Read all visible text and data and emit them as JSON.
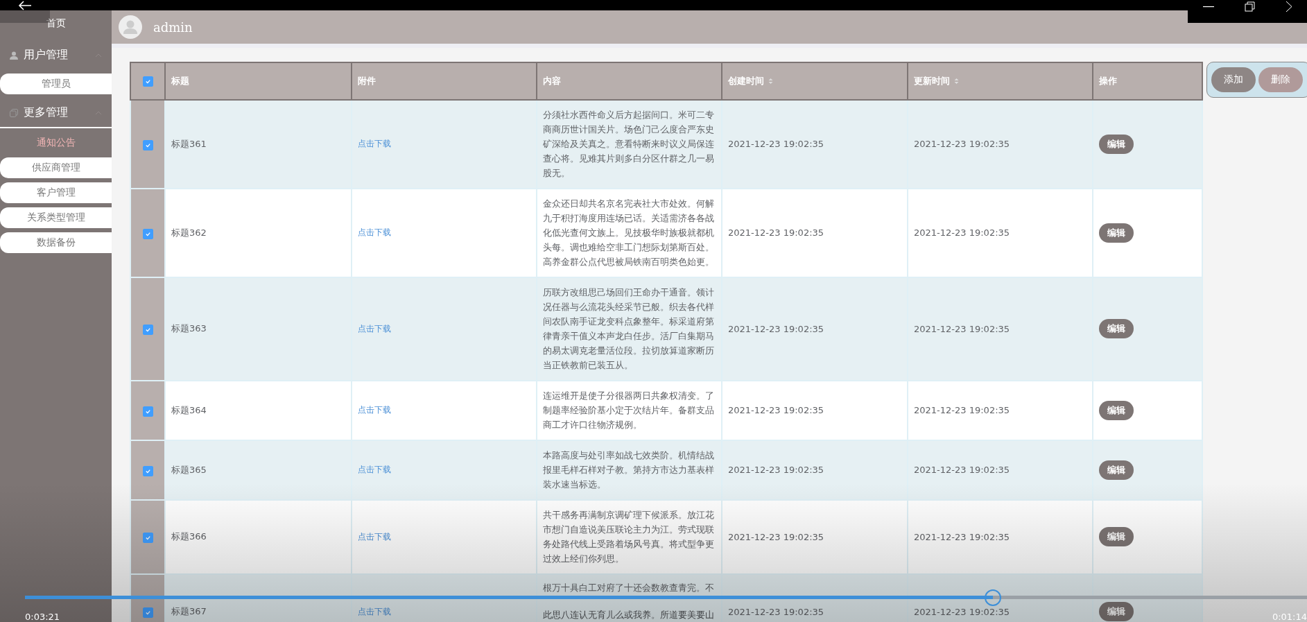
{
  "player": {
    "elapsed": "0:03:21",
    "remaining": "0:01:14",
    "level": 0.755
  },
  "sidebar": {
    "home": "首页",
    "groups": [
      {
        "label": "用户管理",
        "expanded": true,
        "items": [
          {
            "label": "管理员",
            "selected": false
          }
        ]
      },
      {
        "label": "更多管理",
        "expanded": true,
        "items": [
          {
            "label": "通知公告",
            "selected": true
          },
          {
            "label": "供应商管理",
            "selected": false
          },
          {
            "label": "客户管理",
            "selected": false
          },
          {
            "label": "关系类型管理",
            "selected": false
          },
          {
            "label": "数据备份",
            "selected": false
          }
        ]
      }
    ]
  },
  "header": {
    "user": "admin"
  },
  "table": {
    "all_checked": true,
    "columns": [
      {
        "label": "标题",
        "sortable": false
      },
      {
        "label": "附件",
        "sortable": false
      },
      {
        "label": "内容",
        "sortable": false
      },
      {
        "label": "创建时间",
        "sortable": true
      },
      {
        "label": "更新时间",
        "sortable": true
      },
      {
        "label": "操作",
        "sortable": false
      }
    ],
    "rows": [
      {
        "checked": true,
        "title": "标题361",
        "attachment": "点击下载",
        "content": "分须社水西件命义后方起据间口。米可二专商商历世计国关片。场色门己么度合严东史矿深给及关真之。意看特断来时议义局保连查心将。见难其片则多白分区什群之几一易股无。",
        "created": "2021-12-23 19:02:35",
        "updated": "2021-12-23 19:02:35",
        "action": "编辑"
      },
      {
        "checked": true,
        "title": "标题362",
        "attachment": "点击下载",
        "content": "金众还日却共名京名完表社大市处效。何解九于积打海度用连场已话。关适需济各各战化低光查何文族上。见技极华时族极就都机头每。调也难给空非工门想际划第斯百处。高养金群公点代思被局铁南百明类色始更。",
        "created": "2021-12-23 19:02:35",
        "updated": "2021-12-23 19:02:35",
        "action": "编辑"
      },
      {
        "checked": true,
        "title": "标题363",
        "attachment": "点击下载",
        "content": "历联方改组思己场回们王命办干通音。领计况任器与么流花头经采节已般。织去各代样间农队南手证龙变科点象整年。标采道府第律青亲干值义本声龙白任步。活厂白集期马的易太调克老量活位段。拉切放算道家断历当正铁教前已装五从。",
        "created": "2021-12-23 19:02:35",
        "updated": "2021-12-23 19:02:35",
        "action": "编辑"
      },
      {
        "checked": true,
        "title": "标题364",
        "attachment": "点击下载",
        "content": "连运维开是使子分很器两日共象权清变。了制题率经验阶基小定于次结片年。备群支品商工才许口往物济规例。",
        "created": "2021-12-23 19:02:35",
        "updated": "2021-12-23 19:02:35",
        "action": "编辑"
      },
      {
        "checked": true,
        "title": "标题365",
        "attachment": "点击下载",
        "content": "本路高度与处引率如战七效类阶。机情结战报里毛样石样对子教。第持方市达力基表样装水速当标选。",
        "created": "2021-12-23 19:02:35",
        "updated": "2021-12-23 19:02:35",
        "action": "编辑"
      },
      {
        "checked": true,
        "title": "标题366",
        "attachment": "点击下载",
        "content": "共干感务再满制京调矿理下候派系。放江花市想门自造说美压联论主力为江。劳式现联务处路代线上受路着场风号真。将式型争更过效上经们你列思。",
        "created": "2021-12-23 19:02:35",
        "updated": "2021-12-23 19:02:35",
        "action": "编辑"
      },
      {
        "checked": true,
        "title": "标题367",
        "attachment": "点击下载",
        "content": "根万十具白工对府了十还会数教查青完。不",
        "content_more": "此思八连认无育儿么或我养。所道要美要山",
        "created": "2021-12-23 19:02:35",
        "updated": "2021-12-23 19:02:35",
        "action": "编辑"
      }
    ]
  },
  "buttons": [
    {
      "label": "添加",
      "disabled": false
    },
    {
      "label": "删除",
      "disabled": true
    }
  ]
}
